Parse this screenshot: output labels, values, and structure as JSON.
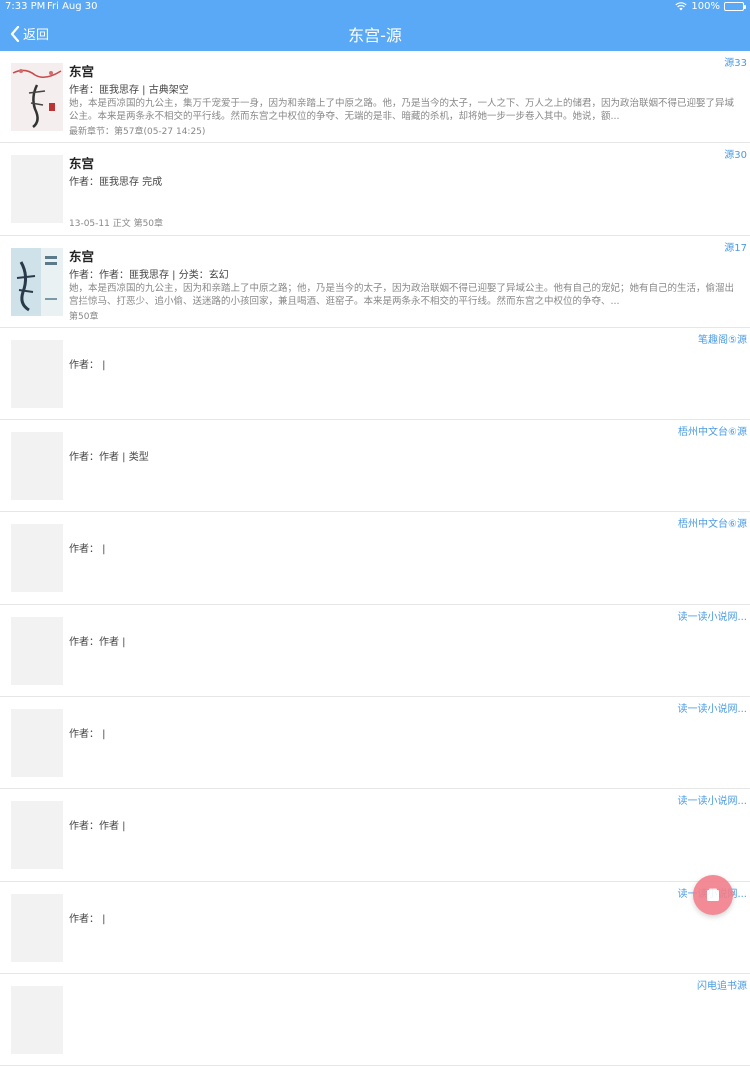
{
  "status_bar": {
    "time": "7:33 PM",
    "date": "Fri Aug 30",
    "battery": "100%"
  },
  "nav": {
    "back_label": "返回",
    "title": "东宫-源"
  },
  "rows": [
    {
      "name": "东宫",
      "author": "作者：匪我思存 | 古典架空",
      "intro": "她，本是西凉国的九公主，集万千宠爱于一身，因为和亲踏上了中原之路。他，乃是当今的太子，一人之下、万人之上的储君，因为政治联姻不得已迎娶了异域公主。本来是两条永不相交的平行线。然而东宫之中权位的争夺、无端的是非、暗藏的杀机，却将她一步一步卷入其中。她说，额...",
      "latest": "最新章节：第57章(05-27 14:25)",
      "source": "源33"
    },
    {
      "name": "东宫",
      "author": "作者：匪我思存  完成",
      "intro": "",
      "latest": "13-05-11  正文 第50章",
      "source": "源30"
    },
    {
      "name": "东宫",
      "author": "作者：作者：匪我思存 | 分类：玄幻",
      "intro": "她，本是西凉国的九公主，因为和亲踏上了中原之路；他，乃是当今的太子，因为政治联姻不得已迎娶了异域公主。他有自己的宠妃；她有自己的生活，偷溜出宫拦惊马、打恶少、追小偷、送迷路的小孩回家，兼且喝酒、逛窑子。本来是两条永不相交的平行线。然而东宫之中权位的争夺、...",
      "latest": "第50章",
      "source": "源17"
    },
    {
      "name": "",
      "author": "作者：  |",
      "intro": "",
      "latest": "",
      "source": "笔趣阁⑤源"
    },
    {
      "name": "",
      "author": "作者：作者 | 类型",
      "intro": "",
      "latest": "",
      "source": "梧州中文台⑥源"
    },
    {
      "name": "",
      "author": "作者：  |",
      "intro": "",
      "latest": "",
      "source": "梧州中文台⑥源"
    },
    {
      "name": "",
      "author": "作者：作者 |",
      "intro": "",
      "latest": "",
      "source": "读一读小说网..."
    },
    {
      "name": "",
      "author": "作者：  |",
      "intro": "",
      "latest": "",
      "source": "读一读小说网..."
    },
    {
      "name": "",
      "author": "作者：作者 |",
      "intro": "",
      "latest": "",
      "source": "读一读小说网..."
    },
    {
      "name": "",
      "author": "作者：  |",
      "intro": "",
      "latest": "",
      "source": "读一读小说网..."
    },
    {
      "name": "",
      "author": "",
      "intro": "",
      "latest": "",
      "source": "闪电追书源"
    }
  ],
  "colors": {
    "nav_bg": "#5aa9f7",
    "link": "#4a9be6",
    "fab": "#f17f8a"
  },
  "icons": {
    "back": "chevron-left-icon",
    "wifi": "wifi-icon",
    "battery": "battery-icon",
    "fab": "bookshelf-icon"
  }
}
